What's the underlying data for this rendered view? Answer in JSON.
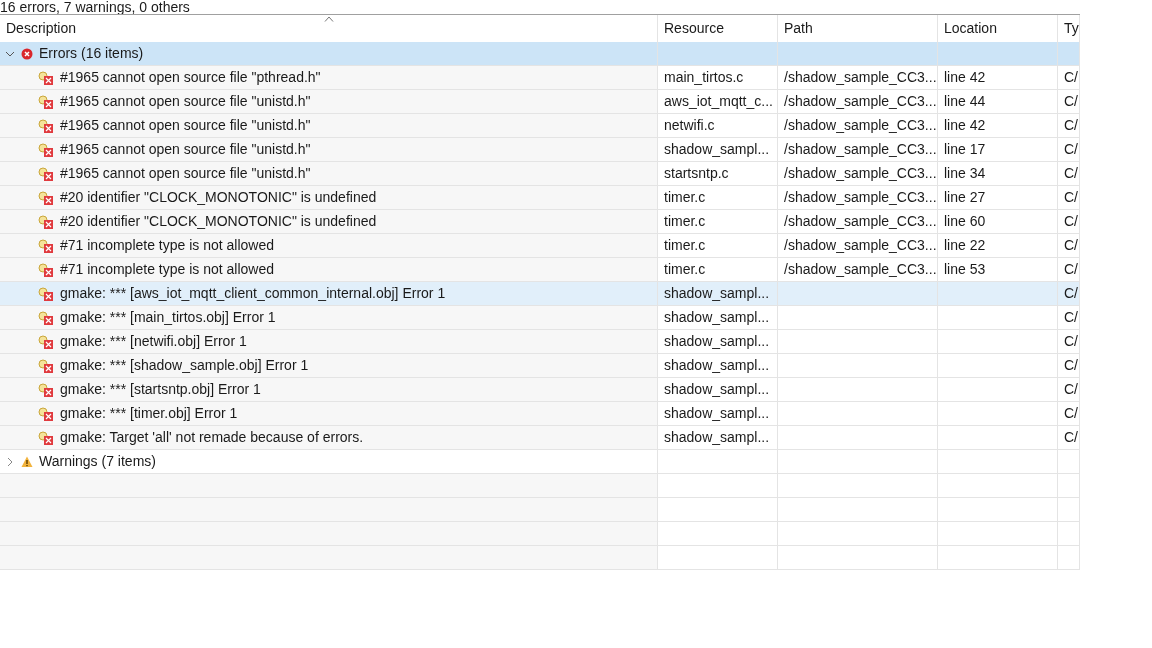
{
  "status": "16 errors, 7 warnings, 0 others",
  "columns": [
    {
      "label": "Description",
      "sorted": true
    },
    {
      "label": "Resource",
      "sorted": false
    },
    {
      "label": "Path",
      "sorted": false
    },
    {
      "label": "Location",
      "sorted": false
    },
    {
      "label": "Ty",
      "sorted": false
    }
  ],
  "groups": [
    {
      "label": "Errors (16 items)",
      "kind": "error",
      "expanded": true,
      "selected": true,
      "items": [
        {
          "description": "#1965 cannot open source file \"pthread.h\"",
          "resource": "main_tirtos.c",
          "path": "/shadow_sample_CC3...",
          "location": "line 42",
          "type": "C/",
          "selected": false
        },
        {
          "description": "#1965 cannot open source file \"unistd.h\"",
          "resource": "aws_iot_mqtt_c...",
          "path": "/shadow_sample_CC3...",
          "location": "line 44",
          "type": "C/",
          "selected": false
        },
        {
          "description": "#1965 cannot open source file \"unistd.h\"",
          "resource": "netwifi.c",
          "path": "/shadow_sample_CC3...",
          "location": "line 42",
          "type": "C/",
          "selected": false
        },
        {
          "description": "#1965 cannot open source file \"unistd.h\"",
          "resource": "shadow_sampl...",
          "path": "/shadow_sample_CC3...",
          "location": "line 17",
          "type": "C/",
          "selected": false
        },
        {
          "description": "#1965 cannot open source file \"unistd.h\"",
          "resource": "startsntp.c",
          "path": "/shadow_sample_CC3...",
          "location": "line 34",
          "type": "C/",
          "selected": false
        },
        {
          "description": "#20 identifier \"CLOCK_MONOTONIC\" is undefined",
          "resource": "timer.c",
          "path": "/shadow_sample_CC3...",
          "location": "line 27",
          "type": "C/",
          "selected": false
        },
        {
          "description": "#20 identifier \"CLOCK_MONOTONIC\" is undefined",
          "resource": "timer.c",
          "path": "/shadow_sample_CC3...",
          "location": "line 60",
          "type": "C/",
          "selected": false
        },
        {
          "description": "#71 incomplete type is not allowed",
          "resource": "timer.c",
          "path": "/shadow_sample_CC3...",
          "location": "line 22",
          "type": "C/",
          "selected": false
        },
        {
          "description": "#71 incomplete type is not allowed",
          "resource": "timer.c",
          "path": "/shadow_sample_CC3...",
          "location": "line 53",
          "type": "C/",
          "selected": false
        },
        {
          "description": "gmake: *** [aws_iot_mqtt_client_common_internal.obj] Error 1",
          "resource": "shadow_sampl...",
          "type": "C/",
          "selected": true
        },
        {
          "description": "gmake: *** [main_tirtos.obj] Error 1",
          "resource": "shadow_sampl...",
          "type": "C/",
          "selected": false
        },
        {
          "description": "gmake: *** [netwifi.obj] Error 1",
          "resource": "shadow_sampl...",
          "type": "C/",
          "selected": false
        },
        {
          "description": "gmake: *** [shadow_sample.obj] Error 1",
          "resource": "shadow_sampl...",
          "type": "C/",
          "selected": false
        },
        {
          "description": "gmake: *** [startsntp.obj] Error 1",
          "resource": "shadow_sampl...",
          "type": "C/",
          "selected": false
        },
        {
          "description": "gmake: *** [timer.obj] Error 1",
          "resource": "shadow_sampl...",
          "type": "C/",
          "selected": false
        },
        {
          "description": "gmake: Target 'all' not remade because of errors.",
          "resource": "shadow_sampl...",
          "type": "C/",
          "selected": false
        }
      ]
    },
    {
      "label": "Warnings (7 items)",
      "kind": "warning",
      "expanded": false,
      "selected": false
    }
  ]
}
